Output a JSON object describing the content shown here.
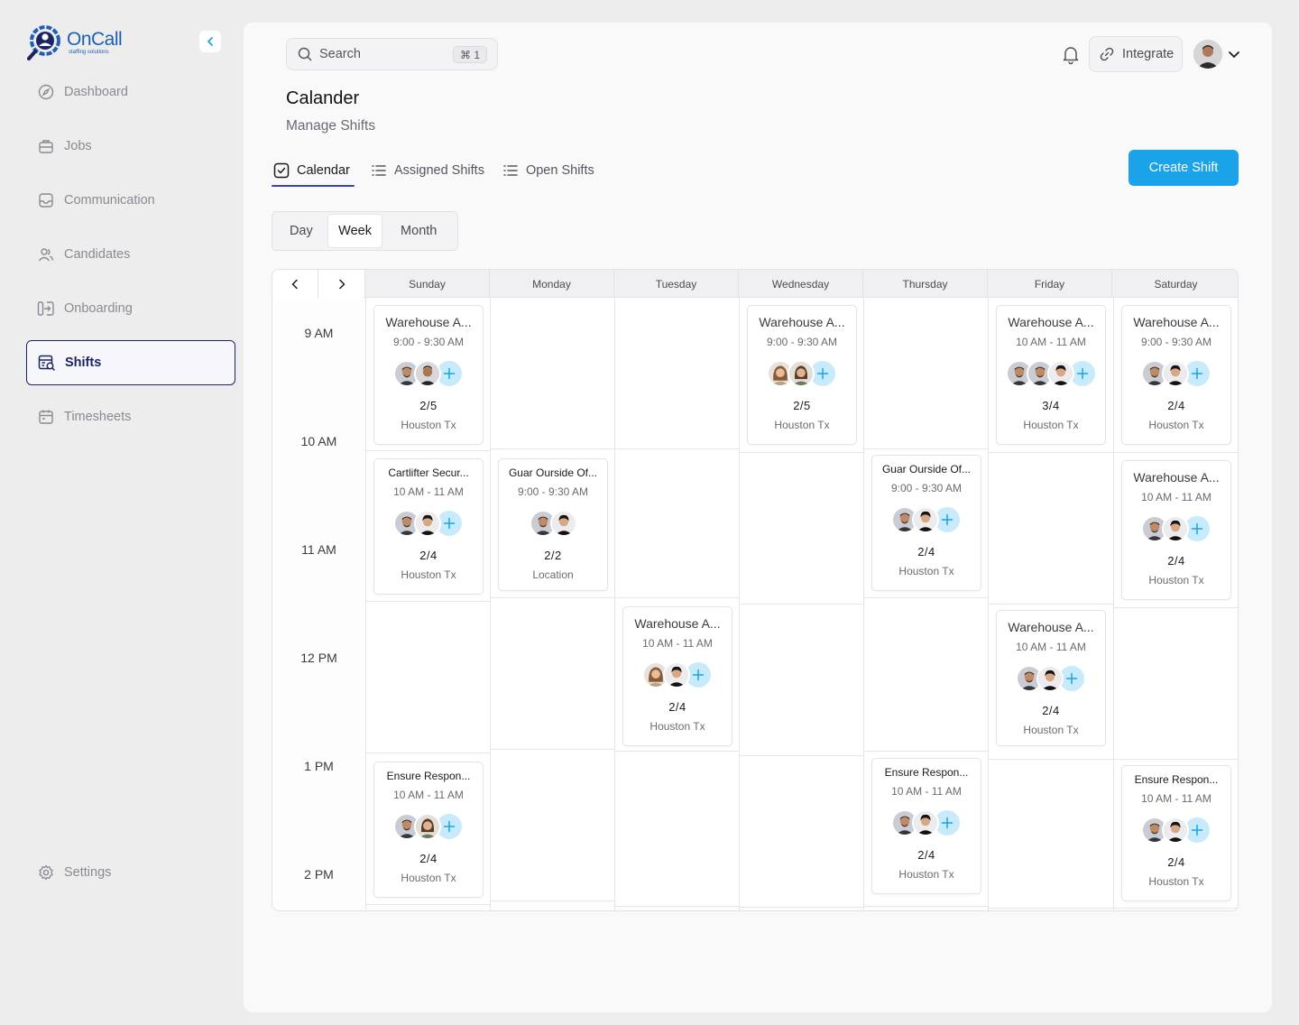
{
  "brand": {
    "name": "OnCall",
    "tagline": "staffing solutions"
  },
  "sidebar": {
    "items": [
      {
        "label": "Dashboard",
        "icon": "dashboard-icon"
      },
      {
        "label": "Jobs",
        "icon": "briefcase-icon"
      },
      {
        "label": "Communication",
        "icon": "inbox-icon"
      },
      {
        "label": "Candidates",
        "icon": "users-icon"
      },
      {
        "label": "Onboarding",
        "icon": "login-icon"
      },
      {
        "label": "Shifts",
        "icon": "shifts-icon",
        "active": true
      },
      {
        "label": "Timesheets",
        "icon": "calendar-icon"
      }
    ],
    "settings": "Settings"
  },
  "header": {
    "search_placeholder": "Search",
    "search_shortcut": "⌘ 1",
    "integrate_label": "Integrate"
  },
  "page": {
    "title": "Calander",
    "subtitle": "Manage Shifts",
    "tabs": [
      {
        "label": "Calendar",
        "active": true
      },
      {
        "label": "Assigned Shifts"
      },
      {
        "label": "Open Shifts"
      }
    ],
    "create_label": "Create Shift",
    "views": {
      "day": "Day",
      "week": "Week",
      "month": "Month",
      "selected": "Week"
    }
  },
  "calendar": {
    "days": [
      "Sunday",
      "Monday",
      "Tuesday",
      "Wednesday",
      "Thursday",
      "Friday",
      "Saturday"
    ],
    "times": [
      "9 AM",
      "10 AM",
      "11 AM",
      "12 PM",
      "1 PM",
      "2 PM"
    ],
    "shifts": [
      {
        "day": 0,
        "title": "Warehouse A...",
        "time": "9:00 - 9:30 AM",
        "count": "2/5",
        "location": "Houston Tx",
        "people": [
          "m1",
          "m2"
        ]
      },
      {
        "day": 0,
        "title": "Cartlifter Secur...",
        "time": "10 AM - 11 AM",
        "count": "2/4",
        "location": "Houston Tx",
        "people": [
          "m1",
          "m3"
        ]
      },
      {
        "day": 0,
        "title": "Ensure Respon...",
        "time": "10 AM - 11 AM",
        "count": "2/4",
        "location": "Houston Tx",
        "people": [
          "m1",
          "f1"
        ]
      },
      {
        "day": 1,
        "title": "Guar Ourside Of...",
        "time": "9:00 - 9:30 AM",
        "count": "2/2",
        "location": "Location",
        "people": [
          "m1",
          "m3"
        ]
      },
      {
        "day": 2,
        "title": "Warehouse A...",
        "time": "10 AM - 11 AM",
        "count": "2/4",
        "location": "Houston Tx",
        "people": [
          "f2",
          "m3"
        ]
      },
      {
        "day": 3,
        "title": "Warehouse A...",
        "time": "9:00 - 9:30 AM",
        "count": "2/5",
        "location": "Houston Tx",
        "people": [
          "f2",
          "f1"
        ]
      },
      {
        "day": 4,
        "title": "Guar Ourside Of...",
        "time": "9:00 - 9:30 AM",
        "count": "2/4",
        "location": "Houston Tx",
        "people": [
          "m1",
          "m3"
        ]
      },
      {
        "day": 4,
        "title": "Ensure Respon...",
        "time": "10 AM - 11 AM",
        "count": "2/4",
        "location": "Houston Tx",
        "people": [
          "m1",
          "m3"
        ]
      },
      {
        "day": 5,
        "title": "Warehouse A...",
        "time": "10 AM - 11 AM",
        "count": "3/4",
        "location": "Houston Tx",
        "people": [
          "m1",
          "m1",
          "m3"
        ]
      },
      {
        "day": 5,
        "title": "Warehouse A...",
        "time": "10 AM - 11 AM",
        "count": "2/4",
        "location": "Houston Tx",
        "people": [
          "m1",
          "m3"
        ]
      },
      {
        "day": 6,
        "title": "Warehouse A...",
        "time": "9:00 - 9:30 AM",
        "count": "2/4",
        "location": "Houston Tx",
        "people": [
          "m1",
          "m3"
        ]
      },
      {
        "day": 6,
        "title": "Warehouse A...",
        "time": "10 AM - 11 AM",
        "count": "2/4",
        "location": "Houston Tx",
        "people": [
          "m1",
          "m3"
        ]
      },
      {
        "day": 6,
        "title": "Ensure Respon...",
        "time": "10 AM - 11 AM",
        "count": "2/4",
        "location": "Houston Tx",
        "people": [
          "m1",
          "m3"
        ]
      }
    ]
  },
  "colors": {
    "accent": "#1ba3ea",
    "active_nav": "#1b2462",
    "tab_underline": "#3b3fc4",
    "plus_bg": "#c7ebfb"
  }
}
